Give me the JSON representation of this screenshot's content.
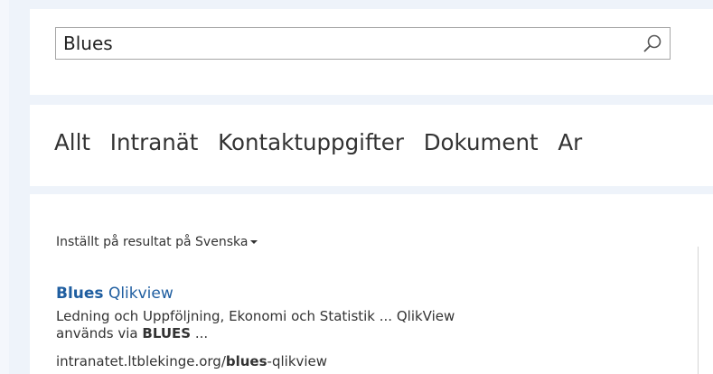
{
  "search": {
    "value": "Blues"
  },
  "tabs": [
    {
      "label": "Allt"
    },
    {
      "label": "Intranät"
    },
    {
      "label": "Kontaktuppgifter"
    },
    {
      "label": "Dokument"
    },
    {
      "label": "Ar"
    }
  ],
  "language_filter": {
    "label": "Inställt på resultat på Svenska"
  },
  "result": {
    "title_bold": "Blues",
    "title_rest": " Qlikview",
    "snippet_line1": "Ledning och Uppföljning, Ekonomi och Statistik ... QlikView",
    "snippet_line2_prefix": "används via ",
    "snippet_line2_bold": "BLUES",
    "snippet_line2_suffix": " ...",
    "url_prefix": "intranatet.ltblekinge.org/",
    "url_bold": "blues",
    "url_suffix": "-qlikview"
  },
  "icons": {
    "search": "search-icon",
    "dropdown": "caret-down-icon"
  }
}
